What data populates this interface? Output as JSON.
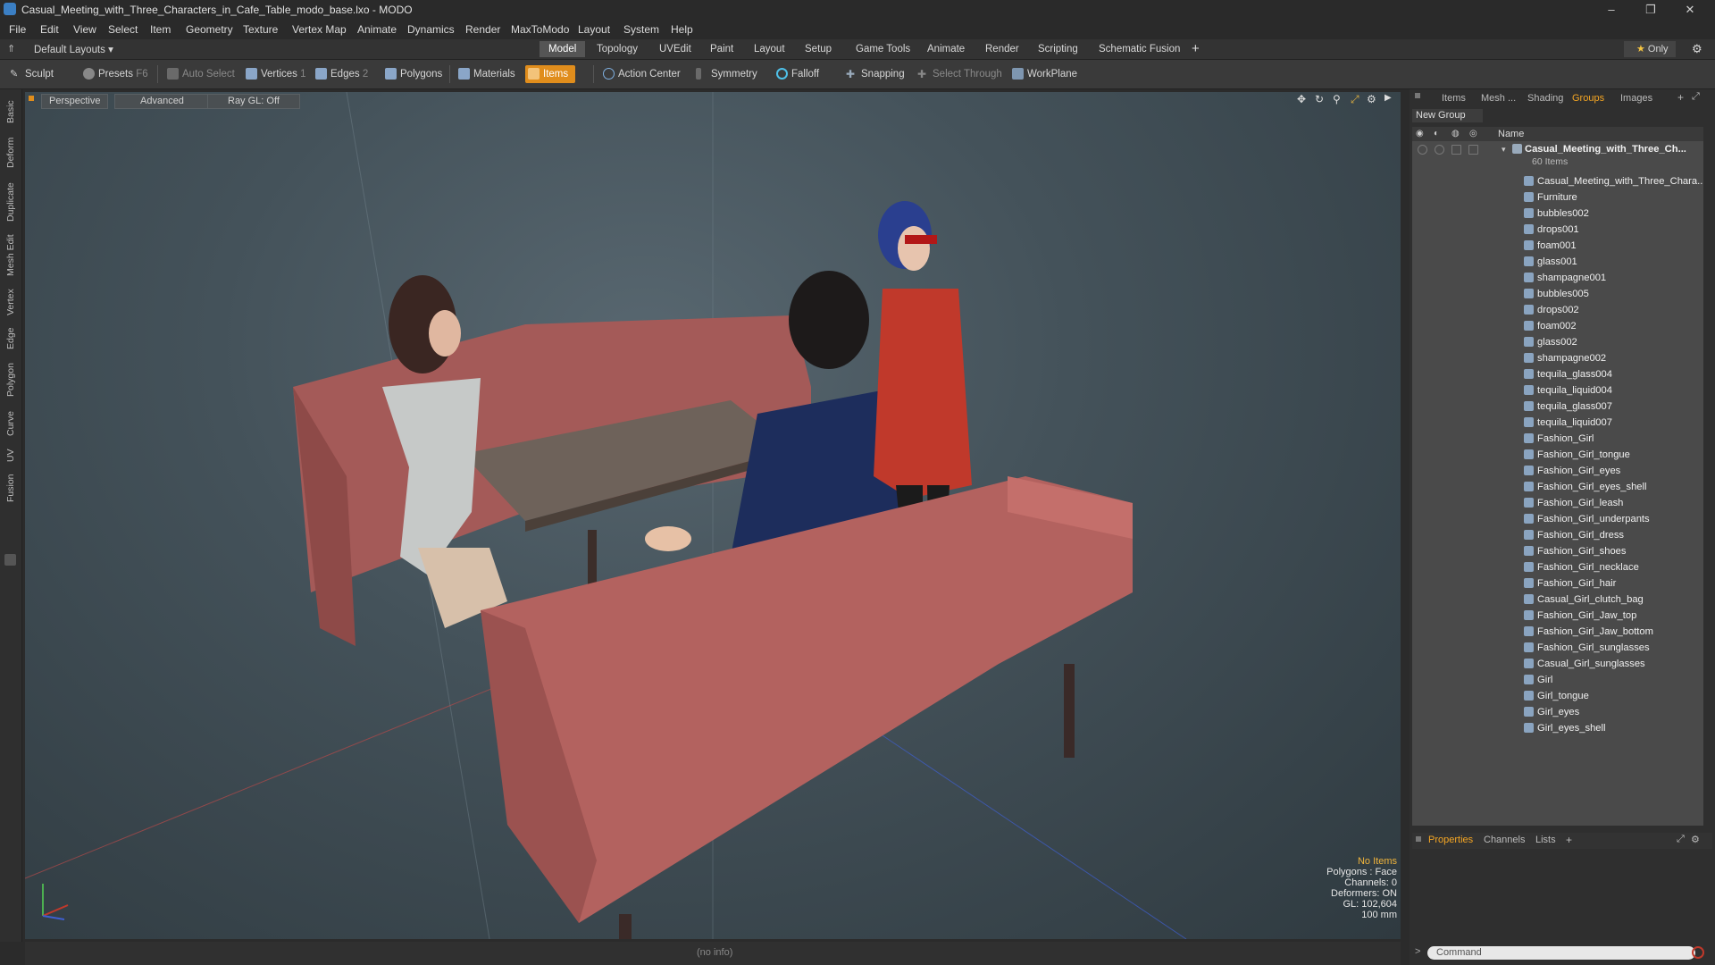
{
  "window": {
    "title": "Casual_Meeting_with_Three_Characters_in_Cafe_Table_modo_base.lxo - MODO",
    "controls": [
      "–",
      "❐",
      "✕"
    ]
  },
  "menu": [
    "File",
    "Edit",
    "View",
    "Select",
    "Item",
    "Geometry",
    "Texture",
    "Vertex Map",
    "Animate",
    "Dynamics",
    "Render",
    "MaxToModo",
    "Layout",
    "System",
    "Help"
  ],
  "layout": {
    "preset": "Default Layouts ▾",
    "tabs": [
      "Model",
      "Topology",
      "UVEdit",
      "Paint",
      "Layout",
      "Setup",
      "Game Tools",
      "Animate",
      "Render",
      "Scripting",
      "Schematic Fusion"
    ],
    "add": "+",
    "only": "Only"
  },
  "tools": {
    "sculpt": "Sculpt",
    "presets": "Presets",
    "presets_key": "F6",
    "auto_select": "Auto Select",
    "vertices": "Vertices",
    "vertices_n": "1",
    "edges": "Edges",
    "edges_n": "2",
    "polygons": "Polygons",
    "materials": "Materials",
    "items": "Items",
    "action_center": "Action Center",
    "symmetry": "Symmetry",
    "falloff": "Falloff",
    "snapping": "Snapping",
    "select_through": "Select Through",
    "workplane": "WorkPlane"
  },
  "left_tabs": [
    "Basic",
    "Deform",
    "Duplicate",
    "Mesh Edit",
    "Vertex",
    "Edge",
    "Polygon",
    "Curve",
    "UV",
    "Fusion"
  ],
  "viewport": {
    "view": "Perspective",
    "shading": "Advanced",
    "raygl": "Ray GL: Off",
    "info": {
      "items": "No Items",
      "polygons": "Polygons : Face",
      "channels": "Channels: 0",
      "deformers": "Deformers: ON",
      "gl": "GL: 102,604",
      "units": "100 mm"
    }
  },
  "status": {
    "text": "(no info)"
  },
  "right_panel": {
    "tabs": [
      "Items",
      "Mesh ...",
      "Shading",
      "Groups",
      "Images"
    ],
    "active_tab": "Groups",
    "new_group": "New Group",
    "col_name": "Name",
    "group_title": "Casual_Meeting_with_Three_Ch...",
    "group_count": "60 Items",
    "items": [
      "Casual_Meeting_with_Three_Chara...",
      "Furniture",
      "bubbles002",
      "drops001",
      "foam001",
      "glass001",
      "shampagne001",
      "bubbles005",
      "drops002",
      "foam002",
      "glass002",
      "shampagne002",
      "tequila_glass004",
      "tequila_liquid004",
      "tequila_glass007",
      "tequila_liquid007",
      "Fashion_Girl",
      "Fashion_Girl_tongue",
      "Fashion_Girl_eyes",
      "Fashion_Girl_eyes_shell",
      "Fashion_Girl_leash",
      "Fashion_Girl_underpants",
      "Fashion_Girl_dress",
      "Fashion_Girl_shoes",
      "Fashion_Girl_necklace",
      "Fashion_Girl_hair",
      "Casual_Girl_clutch_bag",
      "Fashion_Girl_Jaw_top",
      "Fashion_Girl_Jaw_bottom",
      "Fashion_Girl_sunglasses",
      "Casual_Girl_sunglasses",
      "Girl",
      "Girl_tongue",
      "Girl_eyes",
      "Girl_eyes_shell"
    ],
    "bottom_tabs": [
      "Properties",
      "Channels",
      "Lists"
    ],
    "command_placeholder": "Command"
  },
  "colors": {
    "accent": "#e08d1c",
    "active_tab_text": "#f5a623",
    "viewport": "#44525a"
  }
}
